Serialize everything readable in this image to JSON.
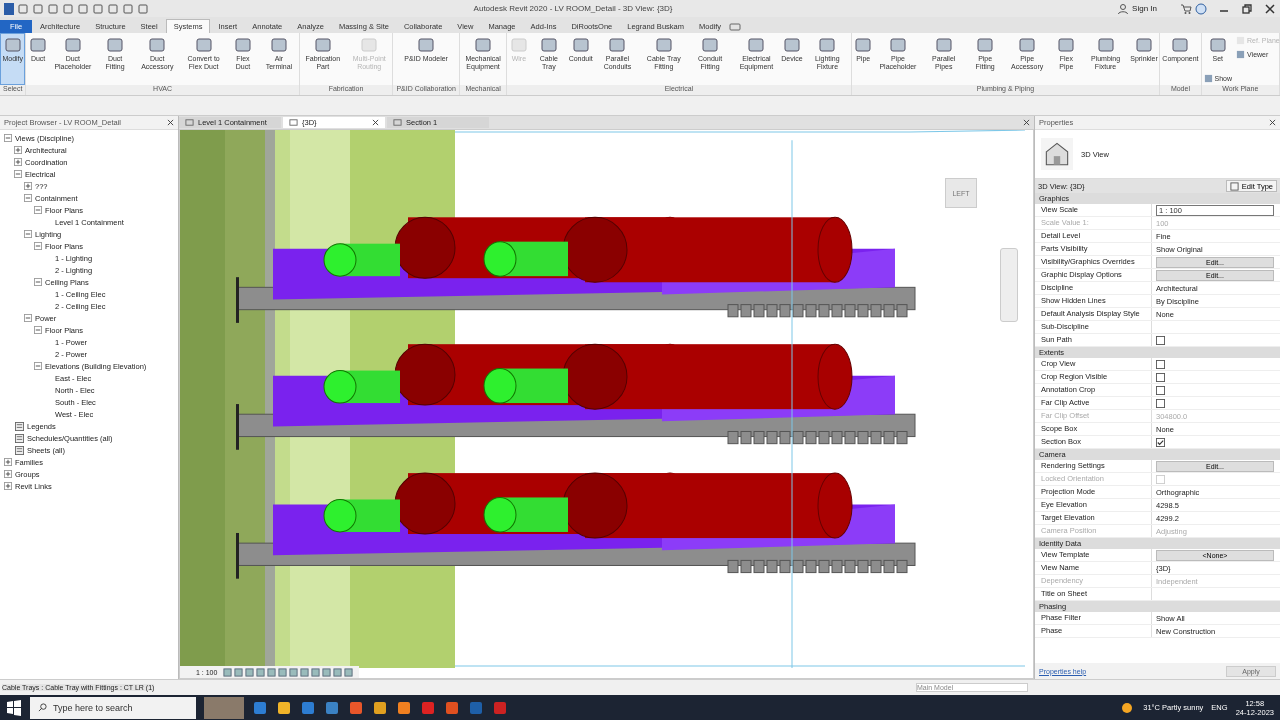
{
  "window": {
    "title": "Autodesk Revit 2020 - LV ROOM_Detail - 3D View: {3D}",
    "sign_in": "Sign In"
  },
  "ribbon_tabs": [
    {
      "label": "File",
      "kind": "file",
      "selected": false
    },
    {
      "label": "Architecture",
      "kind": "tab",
      "selected": false
    },
    {
      "label": "Structure",
      "kind": "tab",
      "selected": false
    },
    {
      "label": "Steel",
      "kind": "tab",
      "selected": false
    },
    {
      "label": "Systems",
      "kind": "tab",
      "selected": true
    },
    {
      "label": "Insert",
      "kind": "tab",
      "selected": false
    },
    {
      "label": "Annotate",
      "kind": "tab",
      "selected": false
    },
    {
      "label": "Analyze",
      "kind": "tab",
      "selected": false
    },
    {
      "label": "Massing & Site",
      "kind": "tab",
      "selected": false
    },
    {
      "label": "Collaborate",
      "kind": "tab",
      "selected": false
    },
    {
      "label": "View",
      "kind": "tab",
      "selected": false
    },
    {
      "label": "Manage",
      "kind": "tab",
      "selected": false
    },
    {
      "label": "Add-Ins",
      "kind": "tab",
      "selected": false
    },
    {
      "label": "DiRootsOne",
      "kind": "tab",
      "selected": false
    },
    {
      "label": "Legrand Buskam",
      "kind": "tab",
      "selected": false
    },
    {
      "label": "Modify",
      "kind": "tab",
      "selected": false
    }
  ],
  "ribbon_panels": [
    {
      "label": "Select",
      "buttons": [
        {
          "label": "Modify",
          "kind": "large",
          "selected": true,
          "disabled": false
        }
      ]
    },
    {
      "label": "HVAC",
      "buttons": [
        {
          "label": "Duct",
          "kind": "large",
          "selected": false,
          "disabled": false
        },
        {
          "label": "Duct Placeholder",
          "kind": "large",
          "selected": false,
          "disabled": false
        },
        {
          "label": "Duct Fitting",
          "kind": "large",
          "selected": false,
          "disabled": false
        },
        {
          "label": "Duct Accessory",
          "kind": "large",
          "selected": false,
          "disabled": false
        },
        {
          "label": "Convert to Flex Duct",
          "kind": "large",
          "selected": false,
          "disabled": false
        },
        {
          "label": "Flex Duct",
          "kind": "large",
          "selected": false,
          "disabled": false
        },
        {
          "label": "Air Terminal",
          "kind": "large",
          "selected": false,
          "disabled": false
        }
      ]
    },
    {
      "label": "Fabrication",
      "buttons": [
        {
          "label": "Fabrication Part",
          "kind": "large",
          "selected": false,
          "disabled": false
        },
        {
          "label": "Multi-Point Routing",
          "kind": "large",
          "selected": false,
          "disabled": true
        }
      ]
    },
    {
      "label": "P&ID Collaboration",
      "buttons": [
        {
          "label": "P&ID Modeler",
          "kind": "large",
          "selected": false,
          "disabled": false
        }
      ]
    },
    {
      "label": "Mechanical",
      "buttons": [
        {
          "label": "Mechanical Equipment",
          "kind": "large",
          "selected": false,
          "disabled": false
        }
      ]
    },
    {
      "label": "Electrical",
      "buttons": [
        {
          "label": "Wire",
          "kind": "large",
          "selected": false,
          "disabled": true
        },
        {
          "label": "Cable Tray",
          "kind": "large",
          "selected": false,
          "disabled": false
        },
        {
          "label": "Conduit",
          "kind": "large",
          "selected": false,
          "disabled": false
        },
        {
          "label": "Parallel Conduits",
          "kind": "large",
          "selected": false,
          "disabled": false
        },
        {
          "label": "Cable Tray Fitting",
          "kind": "large",
          "selected": false,
          "disabled": false
        },
        {
          "label": "Conduit Fitting",
          "kind": "large",
          "selected": false,
          "disabled": false
        },
        {
          "label": "Electrical Equipment",
          "kind": "large",
          "selected": false,
          "disabled": false
        },
        {
          "label": "Device",
          "kind": "large",
          "selected": false,
          "disabled": false
        },
        {
          "label": "Lighting Fixture",
          "kind": "large",
          "selected": false,
          "disabled": false
        }
      ]
    },
    {
      "label": "Plumbing & Piping",
      "buttons": [
        {
          "label": "Pipe",
          "kind": "large",
          "selected": false,
          "disabled": false
        },
        {
          "label": "Pipe Placeholder",
          "kind": "large",
          "selected": false,
          "disabled": false
        },
        {
          "label": "Parallel Pipes",
          "kind": "large",
          "selected": false,
          "disabled": false
        },
        {
          "label": "Pipe Fitting",
          "kind": "large",
          "selected": false,
          "disabled": false
        },
        {
          "label": "Pipe Accessory",
          "kind": "large",
          "selected": false,
          "disabled": false
        },
        {
          "label": "Flex Pipe",
          "kind": "large",
          "selected": false,
          "disabled": false
        },
        {
          "label": "Plumbing Fixture",
          "kind": "large",
          "selected": false,
          "disabled": false
        },
        {
          "label": "Sprinkler",
          "kind": "large",
          "selected": false,
          "disabled": false
        }
      ]
    },
    {
      "label": "Model",
      "buttons": [
        {
          "label": "Component",
          "kind": "large",
          "selected": false,
          "disabled": false
        }
      ]
    },
    {
      "label": "Work Plane",
      "buttons": [
        {
          "label": "Set",
          "kind": "large",
          "selected": false,
          "disabled": false
        },
        {
          "label": "Show",
          "kind": "small",
          "selected": false,
          "disabled": false
        },
        {
          "label": "Ref. Plane",
          "kind": "small",
          "selected": false,
          "disabled": true
        },
        {
          "label": "Viewer",
          "kind": "small",
          "selected": false,
          "disabled": false
        }
      ]
    }
  ],
  "project_browser": {
    "title": "Project Browser - LV ROOM_Detail",
    "items": [
      {
        "label": "Views (Discipline)",
        "expanded": true,
        "children": [
          {
            "label": "Architectural",
            "expanded": false
          },
          {
            "label": "Coordination",
            "expanded": false
          },
          {
            "label": "Electrical",
            "expanded": true,
            "children": [
              {
                "label": "???",
                "expanded": false
              },
              {
                "label": "Containment",
                "expanded": true,
                "children": [
                  {
                    "label": "Floor Plans",
                    "expanded": true,
                    "children": [
                      {
                        "label": "Level 1 Containment"
                      }
                    ]
                  }
                ]
              },
              {
                "label": "Lighting",
                "expanded": true,
                "children": [
                  {
                    "label": "Floor Plans",
                    "expanded": true,
                    "children": [
                      {
                        "label": "1 - Lighting"
                      },
                      {
                        "label": "2 - Lighting"
                      }
                    ]
                  },
                  {
                    "label": "Ceiling Plans",
                    "expanded": true,
                    "children": [
                      {
                        "label": "1 - Ceiling Elec"
                      },
                      {
                        "label": "2 - Ceiling Elec"
                      }
                    ]
                  }
                ]
              },
              {
                "label": "Power",
                "expanded": true,
                "children": [
                  {
                    "label": "Floor Plans",
                    "expanded": true,
                    "children": [
                      {
                        "label": "1 - Power"
                      },
                      {
                        "label": "2 - Power"
                      }
                    ]
                  },
                  {
                    "label": "Elevations (Building Elevation)",
                    "expanded": true,
                    "children": [
                      {
                        "label": "East - Elec"
                      },
                      {
                        "label": "North - Elec"
                      },
                      {
                        "label": "South - Elec"
                      },
                      {
                        "label": "West - Elec"
                      }
                    ]
                  }
                ]
              }
            ]
          }
        ]
      },
      {
        "label": "Legends"
      },
      {
        "label": "Schedules/Quantities (all)"
      },
      {
        "label": "Sheets (all)"
      },
      {
        "label": "Families",
        "expanded": false
      },
      {
        "label": "Groups",
        "expanded": false
      },
      {
        "label": "Revit Links",
        "expanded": false
      }
    ]
  },
  "view_tabs": [
    {
      "label": "Level 1 Containment",
      "selected": false
    },
    {
      "label": "{3D}",
      "selected": true
    },
    {
      "label": "Section 1",
      "selected": false
    }
  ],
  "view": {
    "view_cube": "LEFT",
    "scale": "1 : 100"
  },
  "properties": {
    "title": "Properties",
    "type_name": "3D View",
    "instance": "3D View: {3D}",
    "edit_type": "Edit Type",
    "sections": [
      {
        "label": "Graphics",
        "rows": [
          {
            "name": "View Scale",
            "kind": "field",
            "value": "1 : 100",
            "disabled": false
          },
          {
            "name": "Scale Value    1:",
            "kind": "value",
            "value": "100",
            "disabled": true
          },
          {
            "name": "Detail Level",
            "kind": "value",
            "value": "Fine",
            "disabled": false
          },
          {
            "name": "Parts Visibility",
            "kind": "value",
            "value": "Show Original",
            "disabled": false
          },
          {
            "name": "Visibility/Graphics Overrides",
            "kind": "button",
            "value": "Edit...",
            "disabled": false
          },
          {
            "name": "Graphic Display Options",
            "kind": "button",
            "value": "Edit...",
            "disabled": false
          },
          {
            "name": "Discipline",
            "kind": "value",
            "value": "Architectural",
            "disabled": false
          },
          {
            "name": "Show Hidden Lines",
            "kind": "value",
            "value": "By Discipline",
            "disabled": false
          },
          {
            "name": "Default Analysis Display Style",
            "kind": "value",
            "value": "None",
            "disabled": false
          },
          {
            "name": "Sub-Discipline",
            "kind": "value",
            "disabled": false
          },
          {
            "name": "Sun Path",
            "kind": "check",
            "checked": false,
            "disabled": false
          }
        ]
      },
      {
        "label": "Extents",
        "rows": [
          {
            "name": "Crop View",
            "kind": "check",
            "checked": false,
            "disabled": false
          },
          {
            "name": "Crop Region Visible",
            "kind": "check",
            "checked": false,
            "disabled": false
          },
          {
            "name": "Annotation Crop",
            "kind": "check",
            "checked": false,
            "disabled": false
          },
          {
            "name": "Far Clip Active",
            "kind": "check",
            "checked": false,
            "disabled": false
          },
          {
            "name": "Far Clip Offset",
            "kind": "value",
            "value": "304800.0",
            "disabled": true
          },
          {
            "name": "Scope Box",
            "kind": "value",
            "value": "None",
            "disabled": false
          },
          {
            "name": "Section Box",
            "kind": "check",
            "checked": true,
            "disabled": false
          }
        ]
      },
      {
        "label": "Camera",
        "rows": [
          {
            "name": "Rendering Settings",
            "kind": "button",
            "value": "Edit...",
            "disabled": false
          },
          {
            "name": "Locked Orientation",
            "kind": "check",
            "checked": false,
            "disabled": true
          },
          {
            "name": "Projection Mode",
            "kind": "value",
            "value": "Orthographic",
            "disabled": false
          },
          {
            "name": "Eye Elevation",
            "kind": "value",
            "value": "4298.5",
            "disabled": false
          },
          {
            "name": "Target Elevation",
            "kind": "value",
            "value": "4299.2",
            "disabled": false
          },
          {
            "name": "Camera Position",
            "kind": "value",
            "value": "Adjusting",
            "disabled": true
          }
        ]
      },
      {
        "label": "Identity Data",
        "rows": [
          {
            "name": "View Template",
            "kind": "button",
            "value": "<None>",
            "disabled": false
          },
          {
            "name": "View Name",
            "kind": "value",
            "value": "{3D}",
            "disabled": false
          },
          {
            "name": "Dependency",
            "kind": "value",
            "value": "Independent",
            "disabled": true
          },
          {
            "name": "Title on Sheet",
            "kind": "value",
            "disabled": false
          }
        ]
      },
      {
        "label": "Phasing",
        "rows": [
          {
            "name": "Phase Filter",
            "kind": "value",
            "value": "Show All",
            "disabled": false
          },
          {
            "name": "Phase",
            "kind": "value",
            "value": "New Construction",
            "disabled": false
          }
        ]
      }
    ],
    "help_link": "Properties help",
    "apply": "Apply"
  },
  "status_bar": {
    "text": "Cable Trays : Cable Tray with Fittings : CT LR (1)",
    "model": "Main Model"
  },
  "taskbar": {
    "search_placeholder": "Type here to search",
    "weather": "31°C  Partly sunny",
    "language": "ENG",
    "time": "12:58",
    "date": "24-12-2023"
  }
}
